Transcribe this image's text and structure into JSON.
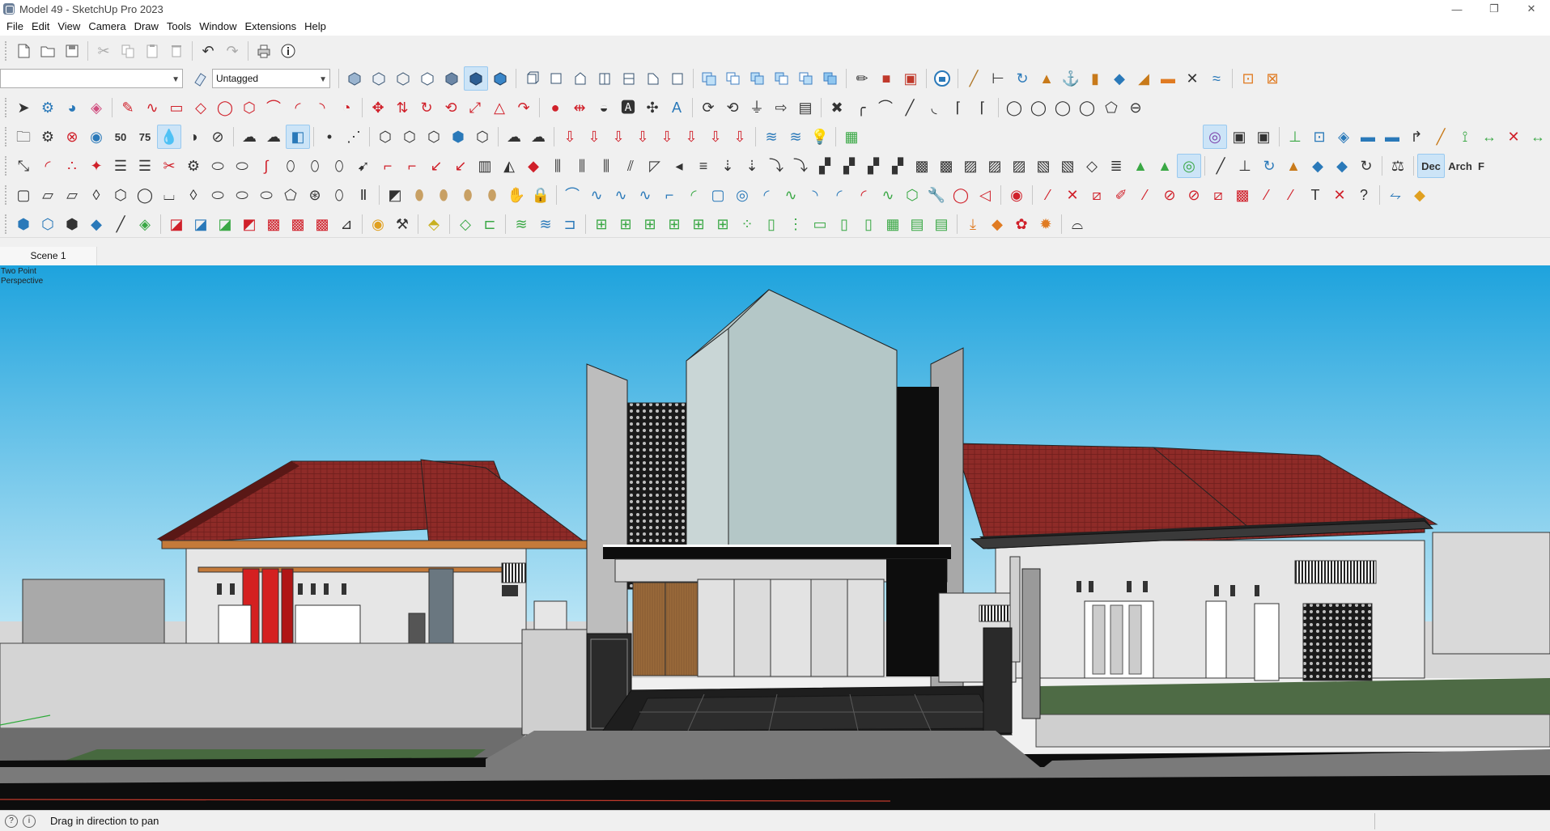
{
  "window": {
    "title": "Model 49 - SketchUp Pro 2023",
    "minimize": "—",
    "maximize": "❐",
    "close": "✕"
  },
  "menu": {
    "items": [
      "File",
      "Edit",
      "View",
      "Camera",
      "Draw",
      "Tools",
      "Window",
      "Extensions",
      "Help"
    ]
  },
  "toolbar": {
    "layer_combo_value": "",
    "tag_combo_value": "Untagged",
    "speed_number_1": "50",
    "speed_number_2": "75",
    "label_dec": "Dec",
    "label_arch": "Arch",
    "label_f": "F"
  },
  "scenes": {
    "tabs": [
      "Scene 1"
    ]
  },
  "viewport": {
    "camera_label_line1": "Two Point",
    "camera_label_line2": "Perspective",
    "sky_top": "#1ea3dd",
    "sky_bottom": "#bfe7f6",
    "roof_color": "#8e2b28",
    "wall_color": "#e6e6e6"
  },
  "status": {
    "message": "Drag in direction to pan"
  }
}
